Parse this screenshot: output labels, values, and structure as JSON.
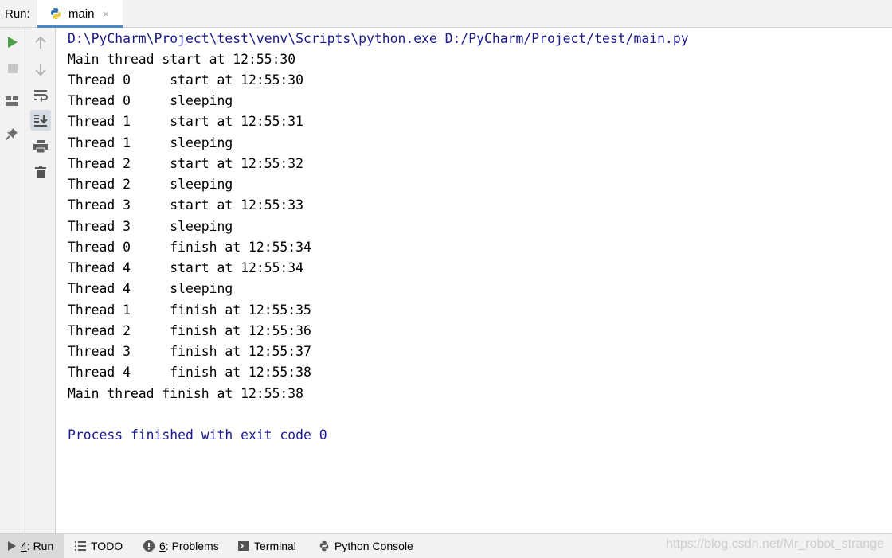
{
  "header": {
    "run_label": "Run:",
    "tab_label": "main",
    "close_glyph": "×"
  },
  "toolbar_left": [
    "run-icon",
    "stop-icon",
    "layout-icon",
    "pin-icon"
  ],
  "toolbar_right": [
    "arrow-up-icon",
    "arrow-down-icon",
    "soft-wrap-icon",
    "scroll-to-end-icon",
    "print-icon",
    "trash-icon"
  ],
  "console": {
    "lines": [
      "D:\\PyCharm\\Project\\test\\venv\\Scripts\\python.exe D:/PyCharm/Project/test/main.py",
      "Main thread start at 12:55:30",
      "Thread 0     start at 12:55:30",
      "Thread 0     sleeping",
      "Thread 1     start at 12:55:31",
      "Thread 1     sleeping",
      "Thread 2     start at 12:55:32",
      "Thread 2     sleeping",
      "Thread 3     start at 12:55:33",
      "Thread 3     sleeping",
      "Thread 0     finish at 12:55:34",
      "Thread 4     start at 12:55:34",
      "Thread 4     sleeping",
      "Thread 1     finish at 12:55:35",
      "Thread 2     finish at 12:55:36",
      "Thread 3     finish at 12:55:37",
      "Thread 4     finish at 12:55:38",
      "Main thread finish at 12:55:38",
      "",
      "Process finished with exit code 0"
    ]
  },
  "bottom_bar": {
    "tabs": [
      {
        "number": "4",
        "label": ": Run",
        "icon": "run-tri-icon"
      },
      {
        "number": "",
        "label": "TODO",
        "icon": "list-icon"
      },
      {
        "number": "6",
        "label": ": Problems",
        "icon": "info-icon"
      },
      {
        "number": "",
        "label": "Terminal",
        "icon": "terminal-icon"
      },
      {
        "number": "",
        "label": "Python Console",
        "icon": "python-icon"
      }
    ],
    "watermark": "https://blog.csdn.net/Mr_robot_strange"
  },
  "colors": {
    "system_text": "#1a1a8c",
    "run_green": "#4ea14b",
    "tab_underline": "#4a88c7"
  }
}
